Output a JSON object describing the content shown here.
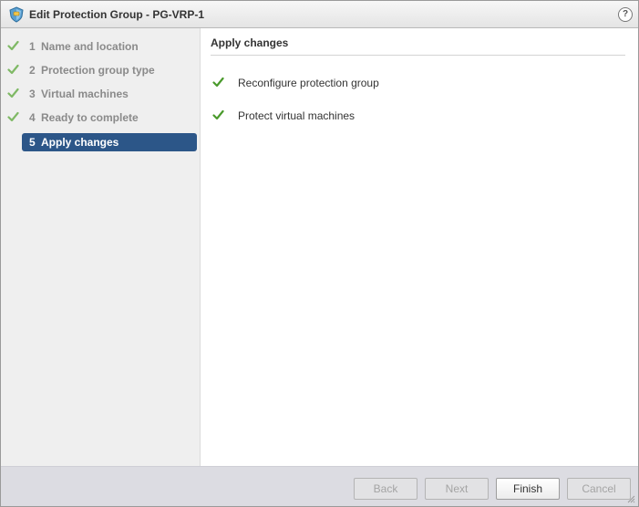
{
  "window": {
    "title": "Edit Protection Group - PG-VRP-1",
    "help_label": "?"
  },
  "steps": [
    {
      "number": "1",
      "label": "Name and location",
      "status": "complete"
    },
    {
      "number": "2",
      "label": "Protection group type",
      "status": "complete"
    },
    {
      "number": "3",
      "label": "Virtual machines",
      "status": "complete"
    },
    {
      "number": "4",
      "label": "Ready to complete",
      "status": "complete"
    },
    {
      "number": "5",
      "label": "Apply changes",
      "status": "active"
    }
  ],
  "content": {
    "title": "Apply changes",
    "tasks": [
      {
        "label": "Reconfigure protection group",
        "status": "success"
      },
      {
        "label": "Protect virtual machines",
        "status": "success"
      }
    ]
  },
  "footer": {
    "back_label": "Back",
    "next_label": "Next",
    "finish_label": "Finish",
    "cancel_label": "Cancel"
  },
  "colors": {
    "active_step": "#2c5688",
    "check_green": "#5aa83c",
    "sidebar_bg": "#efefef",
    "footer_bg": "#dcdce2"
  },
  "icons": {
    "title": "protection-group-shield-icon",
    "complete": "checkmark-icon",
    "help": "help-icon",
    "resize": "resize-grip-icon"
  }
}
